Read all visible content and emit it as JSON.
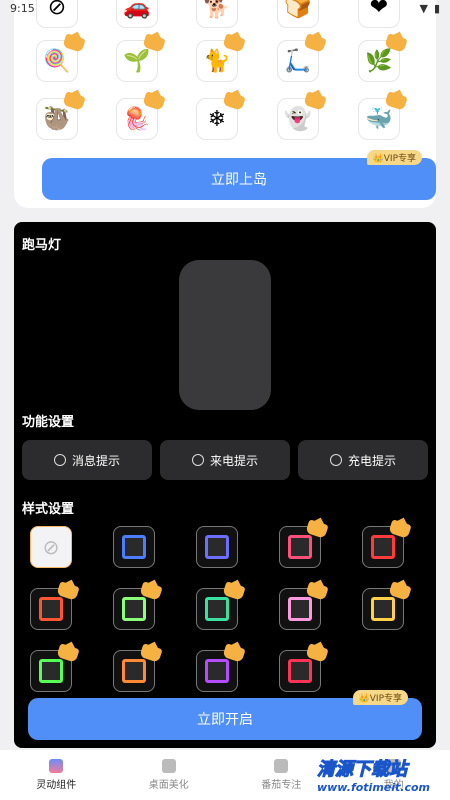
{
  "status": {
    "time": "9:15",
    "icons": [
      "wifi-icon",
      "battery-icon"
    ]
  },
  "island_grid": [
    {
      "icon": "forbidden-icon",
      "glyph": "⊘"
    },
    {
      "icon": "car-icon",
      "glyph": "🚗"
    },
    {
      "icon": "corgi-icon",
      "glyph": "🐕"
    },
    {
      "icon": "toast-icon",
      "glyph": "🍞"
    },
    {
      "icon": "heart-icon",
      "glyph": "❤"
    },
    {
      "icon": "stick-toy-icon",
      "glyph": "🍭"
    },
    {
      "icon": "grass-icon",
      "glyph": "🌱"
    },
    {
      "icon": "black-cat-icon",
      "glyph": "🐈"
    },
    {
      "icon": "scooter-icon",
      "glyph": "🛴"
    },
    {
      "icon": "willow-icon",
      "glyph": "🌿"
    },
    {
      "icon": "sloth-icon",
      "glyph": "🦥"
    },
    {
      "icon": "jellyfish-icon",
      "glyph": "🪼"
    },
    {
      "icon": "snowflake-icon",
      "glyph": "❄"
    },
    {
      "icon": "ghost-icon",
      "glyph": "👻"
    },
    {
      "icon": "whale-icon",
      "glyph": "🐳"
    }
  ],
  "top_button": {
    "label": "立即上岛",
    "vip": "👑VIP专享"
  },
  "marquee": {
    "title": "跑马灯",
    "function_title": "功能设置",
    "functions": [
      "消息提示",
      "来电提示",
      "充电提示"
    ],
    "style_title": "样式设置",
    "styles": [
      {
        "name": "none",
        "color": ""
      },
      {
        "name": "style-1",
        "color": "#4c7dff"
      },
      {
        "name": "style-2",
        "color": "#6d6dff"
      },
      {
        "name": "style-3",
        "color": "#ff4f7b"
      },
      {
        "name": "style-4",
        "color": "#ff3b3b"
      },
      {
        "name": "style-5",
        "color": "#ff5533"
      },
      {
        "name": "style-6",
        "color": "#8cff7a"
      },
      {
        "name": "style-7",
        "color": "#3ce0a0"
      },
      {
        "name": "style-8",
        "color": "#ff9ae0"
      },
      {
        "name": "style-9",
        "color": "#ffd04a"
      },
      {
        "name": "style-10",
        "color": "#56ff56"
      },
      {
        "name": "style-11",
        "color": "#ff8a33"
      },
      {
        "name": "style-12",
        "color": "#b54dff"
      },
      {
        "name": "style-13",
        "color": "#ff3355"
      }
    ],
    "start_button": "立即开启",
    "vip": "👑VIP专享"
  },
  "nav": [
    {
      "label": "灵动组件",
      "active": true
    },
    {
      "label": "桌面美化",
      "active": false
    },
    {
      "label": "番茄专注",
      "active": false
    },
    {
      "label": "我的",
      "active": false
    }
  ],
  "watermark": {
    "line1": "清源下载站",
    "line2": "www.fotimeit.com"
  },
  "colors": {
    "accent": "#4f8ff7",
    "vip_bg": "#f7d888",
    "panel_bg": "#000000"
  }
}
